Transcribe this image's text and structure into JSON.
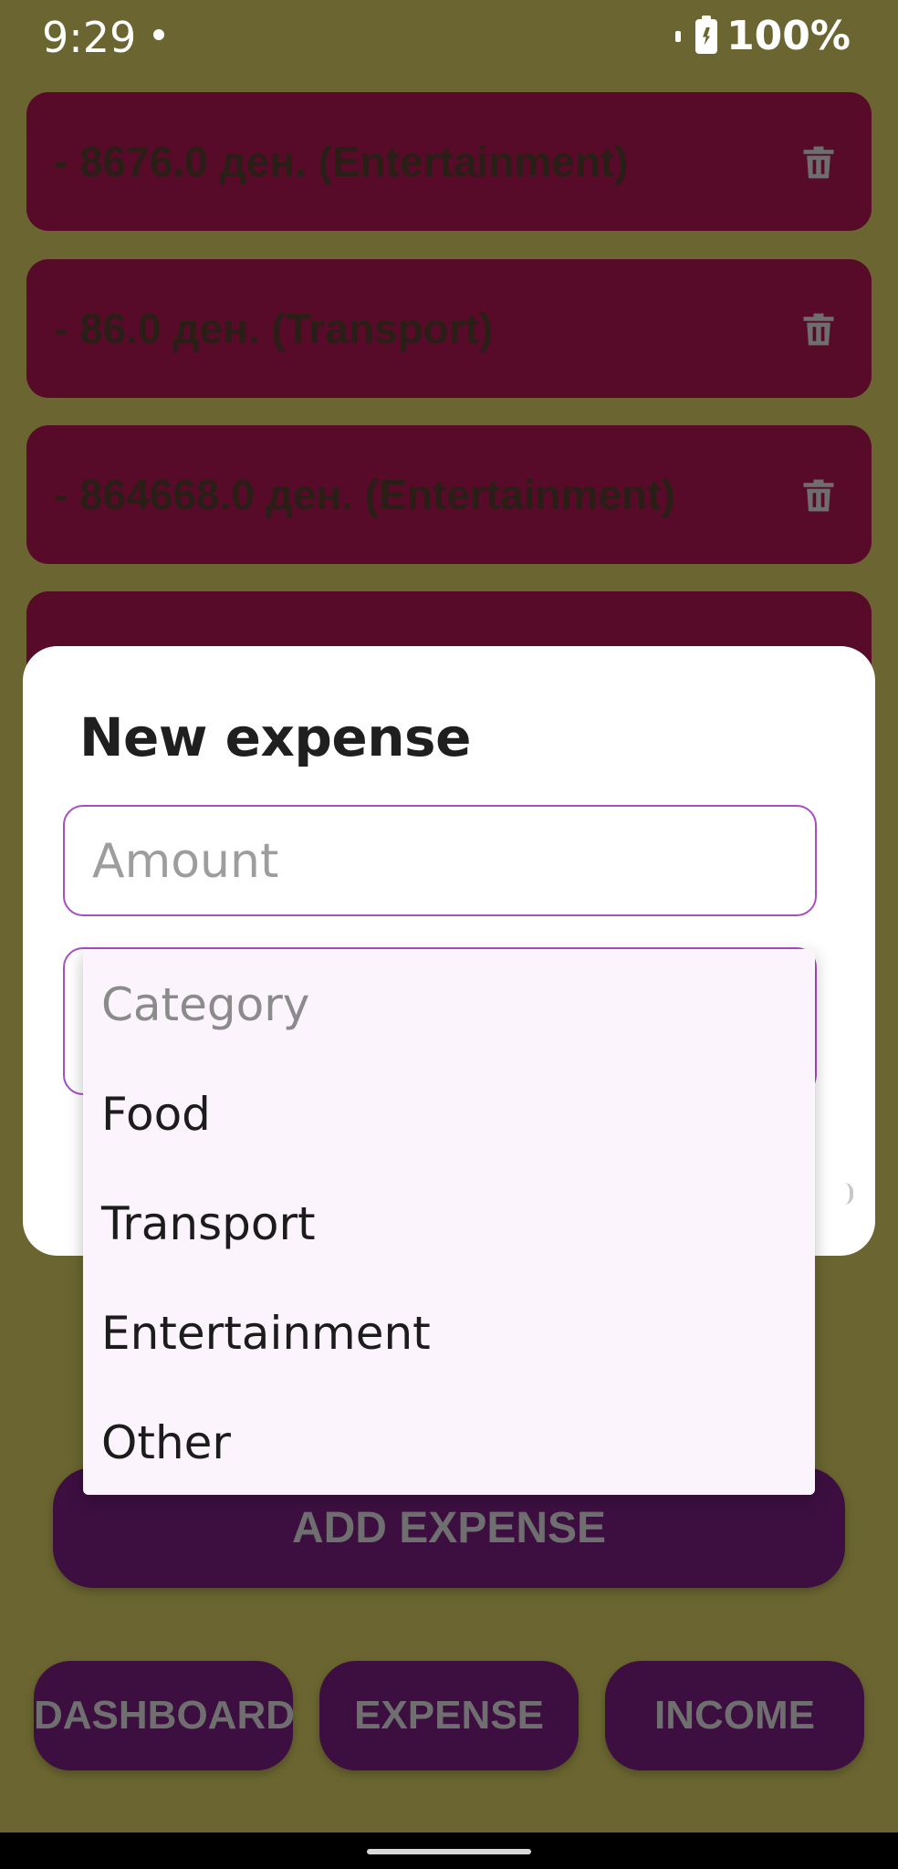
{
  "status_bar": {
    "time": "9:29",
    "battery": "100%"
  },
  "expenses": [
    {
      "text": "- 8676.0 ден. (Entertainment)"
    },
    {
      "text": "- 86.0 ден. (Transport)"
    },
    {
      "text": "- 864668.0 ден. (Entertainment)"
    }
  ],
  "dialog": {
    "title": "New expense",
    "amount_placeholder": "Amount",
    "category_placeholder": "Category",
    "category_options": [
      "Food",
      "Transport",
      "Entertainment",
      "Other"
    ]
  },
  "add_expense_label": "ADD EXPENSE",
  "nav": {
    "dashboard": "DASHBOARD",
    "expense": "EXPENSE",
    "income": "INCOME"
  },
  "colors": {
    "background": "#6b6631",
    "card": "#570b28",
    "button": "#3d0f41",
    "accent": "#a64fc4",
    "dropdown": "#fcf4fc"
  }
}
